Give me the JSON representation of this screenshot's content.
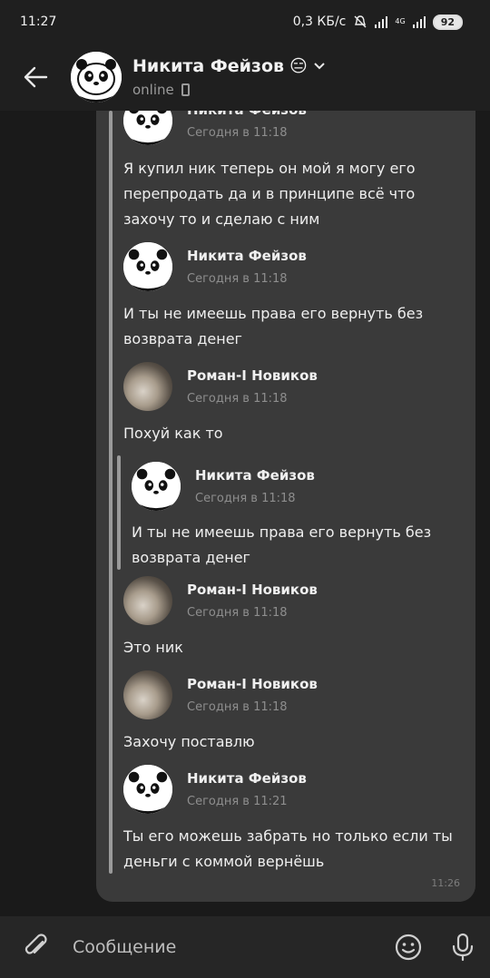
{
  "status_bar": {
    "time": "11:27",
    "speed": "0,3 КБ/с",
    "network": "4G",
    "battery": "92"
  },
  "header": {
    "name": "Никита Фейзов",
    "emoji": "😑",
    "status": "online"
  },
  "messages": [
    {
      "author": "Никита Фейзов",
      "time": "Сегодня в 11:18",
      "text": "Я купил ник теперь он мой я могу его перепродать да и в принципе всё что захочу то и сделаю с ним",
      "avatar": "panda"
    },
    {
      "author": "Никита Фейзов",
      "time": "Сегодня в 11:18",
      "text": "И ты не имеешь права его вернуть без возврата денег",
      "avatar": "panda"
    },
    {
      "author": "Роман-I Новиков",
      "time": "Сегодня в 11:18",
      "text": "Похуй как то",
      "avatar": "photo"
    },
    {
      "author": "Никита Фейзов",
      "time": "Сегодня в 11:18",
      "text": "И ты не имеешь права его вернуть без возврата денег",
      "avatar": "panda"
    },
    {
      "author": "Роман-I Новиков",
      "time": "Сегодня в 11:18",
      "text": "Это ник",
      "avatar": "photo"
    },
    {
      "author": "Роман-I Новиков",
      "time": "Сегодня в 11:18",
      "text": "Захочу поставлю",
      "avatar": "photo"
    },
    {
      "author": "Никита Фейзов",
      "time": "Сегодня в 11:21",
      "text": "Ты его можешь забрать но только если ты деньги с коммой вернёшь",
      "avatar": "panda"
    }
  ],
  "bubble_time": "11:26",
  "input": {
    "placeholder": "Сообщение"
  },
  "colors": {
    "background": "#1a1a1a",
    "bubble": "#3a3a3a",
    "header": "#1f1f1f",
    "forward_line": "#9a9a9a"
  },
  "icons": [
    "back-arrow-icon",
    "chevron-down-icon",
    "phone-icon",
    "attach-icon",
    "emoji-icon",
    "microphone-icon",
    "mute-icon",
    "signal-icon",
    "battery-icon"
  ]
}
